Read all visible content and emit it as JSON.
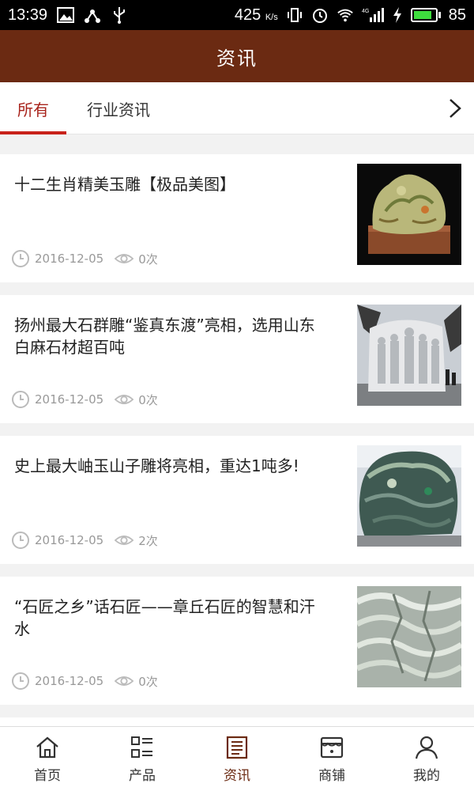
{
  "status_bar": {
    "time": "13:39",
    "net_speed": "425",
    "net_unit": "K/s",
    "signal_label": "4G",
    "battery_percent": "85",
    "battery_level": 0.85
  },
  "header": {
    "title": "资讯"
  },
  "tabs": [
    {
      "label": "所有",
      "active": true
    },
    {
      "label": "行业资讯",
      "active": false
    }
  ],
  "articles": [
    {
      "title": "十二生肖精美玉雕【极品美图】",
      "date": "2016-12-05",
      "views": "0次",
      "image": "jade-zodiac-carving"
    },
    {
      "title": "扬州最大石群雕“鉴真东渡”亮相，选用山东白麻石材超百吨",
      "date": "2016-12-05",
      "views": "0次",
      "image": "stone-group-sculpture"
    },
    {
      "title": "史上最大岫玉山子雕将亮相，重达1吨多!",
      "date": "2016-12-05",
      "views": "2次",
      "image": "xiuyan-jade-mountain"
    },
    {
      "title": "“石匠之乡”话石匠——章丘石匠的智慧和汗水",
      "date": "2016-12-05",
      "views": "0次",
      "image": "stone-relief-carving"
    }
  ],
  "bottom_nav": [
    {
      "label": "首页",
      "icon": "home-icon",
      "active": false
    },
    {
      "label": "产品",
      "icon": "grid-list-icon",
      "active": false
    },
    {
      "label": "资讯",
      "icon": "news-icon",
      "active": true
    },
    {
      "label": "商铺",
      "icon": "shop-icon",
      "active": false
    },
    {
      "label": "我的",
      "icon": "user-icon",
      "active": false
    }
  ],
  "colors": {
    "brand": "#6b2a12",
    "active_tab": "#c8221a",
    "meta_text": "#999999"
  }
}
